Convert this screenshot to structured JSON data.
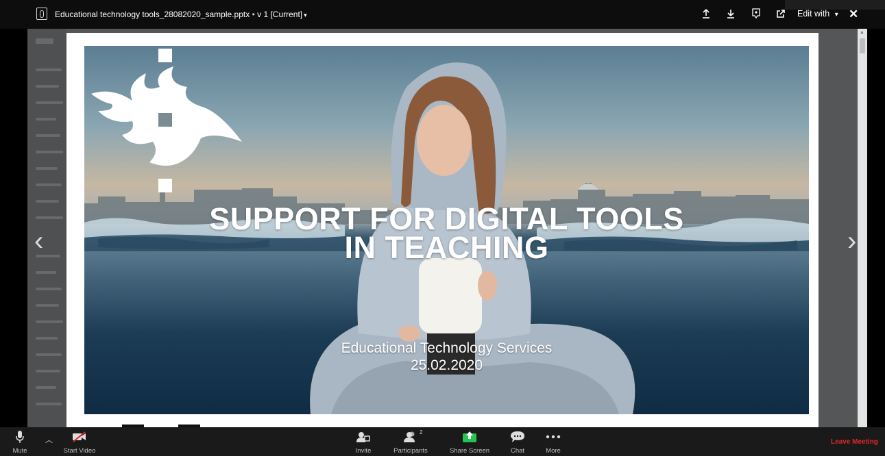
{
  "topbar": {
    "file_name": "Educational technology tools_28082020_sample.pptx",
    "separator": "•",
    "version_label": "v 1 [Current]",
    "version_caret": "▾",
    "edit_with_label": "Edit with",
    "edit_caret": "▾"
  },
  "slide": {
    "title_line1": "SUPPORT FOR DIGITAL TOOLS",
    "title_line2": "IN TEACHING",
    "subtitle": "Educational Technology Services",
    "date": "25.02.2020"
  },
  "viewer": {
    "prev_arrow": "‹",
    "next_arrow": "›"
  },
  "meeting_toolbar": {
    "mute_label": "Mute",
    "start_video_label": "Start Video",
    "invite_label": "Invite",
    "participants_label": "Participants",
    "participants_count": "2",
    "share_screen_label": "Share Screen",
    "chat_label": "Chat",
    "more_label": "More",
    "leave_label": "Leave Meeting"
  },
  "colors": {
    "leave_red": "#e02828",
    "share_green": "#23c552",
    "toolbar_bg": "#1a1a1a",
    "viewer_bg": "#555658"
  },
  "icons": [
    "file-icon",
    "upload-icon",
    "download-icon",
    "comment-icon",
    "open-external-icon",
    "close-icon",
    "microphone-icon",
    "caret-up-icon",
    "video-off-icon",
    "invite-icon",
    "participants-icon",
    "share-screen-icon",
    "chat-icon",
    "more-icon"
  ]
}
